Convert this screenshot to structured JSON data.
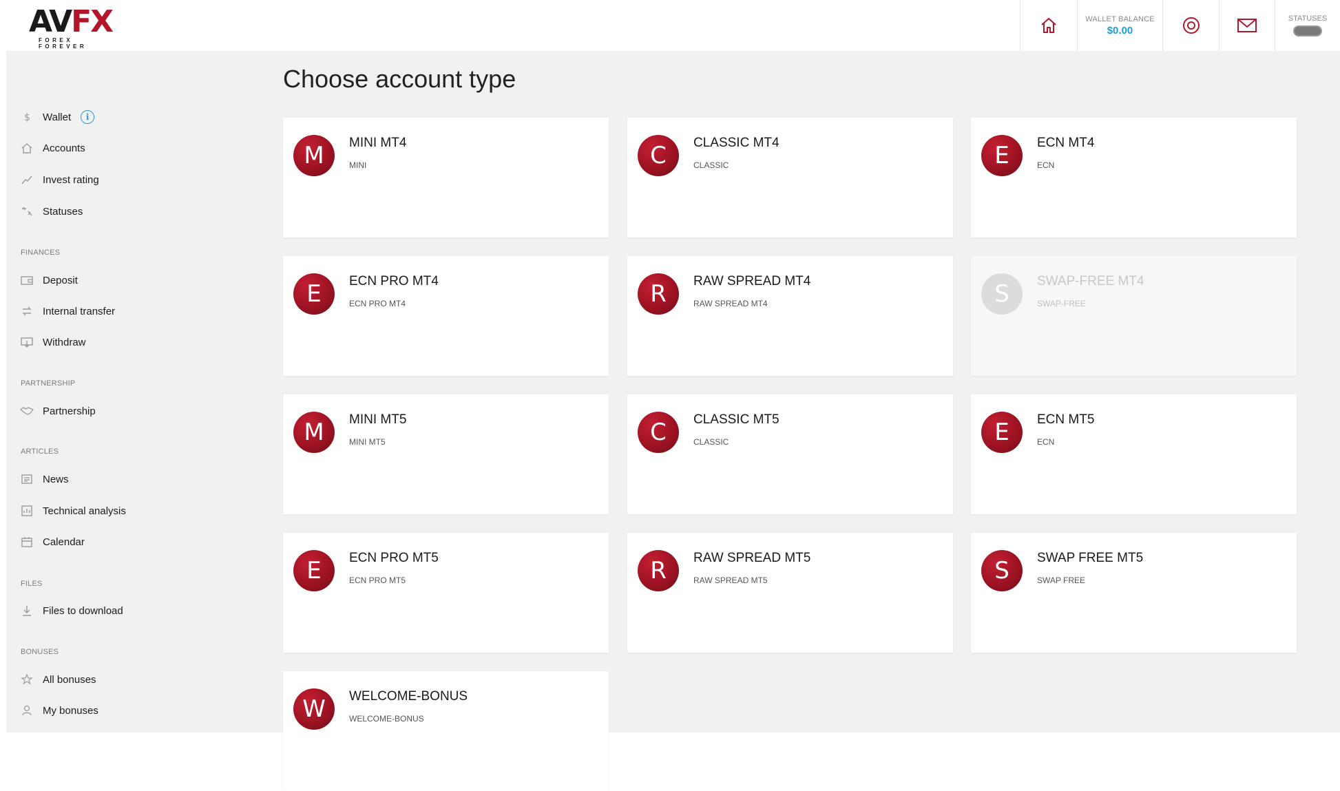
{
  "brand": {
    "logo_main_a": "AV",
    "logo_main_fx": "FX",
    "logo_tagline": "FOREX FOREVER"
  },
  "header": {
    "wallet_label": "WALLET BALANCE",
    "wallet_value": "$0.00",
    "statuses_label": "STATUSES",
    "icons": [
      "home-icon",
      "support-icon",
      "mail-icon"
    ]
  },
  "sidebar": {
    "wallet": "Wallet",
    "accounts": "Accounts",
    "invest_rating": "Invest rating",
    "statuses": "Statuses",
    "sec_finances": "FINANCES",
    "deposit": "Deposit",
    "internal_transfer": "Internal transfer",
    "withdraw": "Withdraw",
    "sec_partnership": "PARTNERSHIP",
    "partnership": "Partnership",
    "sec_articles": "ARTICLES",
    "news": "News",
    "technical_analysis": "Technical analysis",
    "calendar": "Calendar",
    "sec_files": "FILES",
    "files_to_download": "Files to download",
    "sec_bonuses": "BONUSES",
    "all_bonuses": "All bonuses",
    "my_bonuses": "My bonuses"
  },
  "main": {
    "title": "Choose account type",
    "cards": [
      {
        "letter": "M",
        "title": "MINI MT4",
        "sub": "MINI",
        "disabled": false
      },
      {
        "letter": "C",
        "title": "CLASSIC MT4",
        "sub": "CLASSIC",
        "disabled": false
      },
      {
        "letter": "E",
        "title": "ECN MT4",
        "sub": "ECN",
        "disabled": false
      },
      {
        "letter": "E",
        "title": "ECN PRO MT4",
        "sub": "ECN  PRO MT4",
        "disabled": false
      },
      {
        "letter": "R",
        "title": "RAW SPREAD MT4",
        "sub": "RAW SPREAD MT4",
        "disabled": false
      },
      {
        "letter": "S",
        "title": "SWAP-FREE MT4",
        "sub": "SWAP-FREE",
        "disabled": true
      },
      {
        "letter": "M",
        "title": "MINI MT5",
        "sub": "MINI MT5",
        "disabled": false
      },
      {
        "letter": "C",
        "title": "CLASSIC MT5",
        "sub": "CLASSIC",
        "disabled": false
      },
      {
        "letter": "E",
        "title": "ECN MT5",
        "sub": "ECN",
        "disabled": false
      },
      {
        "letter": "E",
        "title": "ECN PRO MT5",
        "sub": "ECN PRO MT5",
        "disabled": false
      },
      {
        "letter": "R",
        "title": "RAW SPREAD MT5",
        "sub": "RAW SPREAD MT5",
        "disabled": false
      },
      {
        "letter": "S",
        "title": "SWAP FREE MT5",
        "sub": "SWAP FREE",
        "disabled": false
      },
      {
        "letter": "W",
        "title": "WELCOME-BONUS",
        "sub": "WELCOME-BONUS",
        "disabled": false
      }
    ]
  },
  "colors": {
    "accent_red": "#b3162a",
    "balance_blue": "#1e9ed6",
    "background": "#f1f1f1"
  }
}
